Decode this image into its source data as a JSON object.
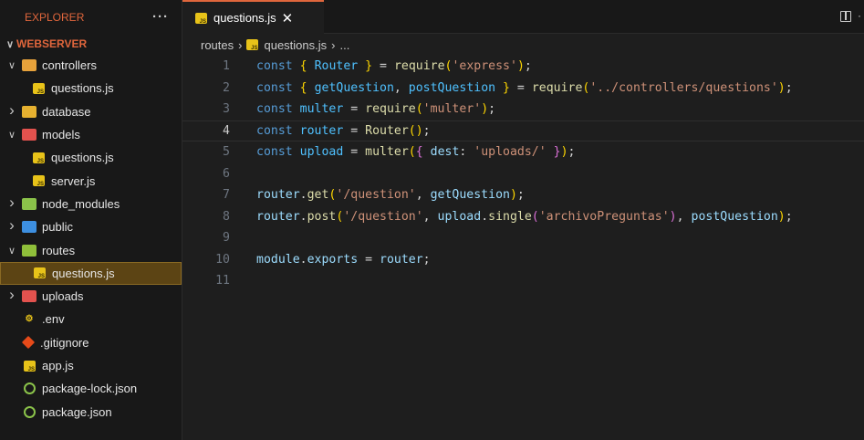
{
  "explorer": {
    "title": "EXPLORER",
    "more": "···",
    "root": "WEBSERVER",
    "items": [
      {
        "label": "controllers",
        "type": "folder",
        "state": "open",
        "color": "orange",
        "depth": 0
      },
      {
        "label": "questions.js",
        "type": "js",
        "depth": 1
      },
      {
        "label": "database",
        "type": "folder",
        "state": "closed",
        "color": "yellow",
        "depth": 0
      },
      {
        "label": "models",
        "type": "folder",
        "state": "open",
        "color": "red",
        "depth": 0
      },
      {
        "label": "questions.js",
        "type": "js",
        "depth": 1
      },
      {
        "label": "server.js",
        "type": "js",
        "depth": 1
      },
      {
        "label": "node_modules",
        "type": "folder",
        "state": "closed",
        "color": "node",
        "depth": 0
      },
      {
        "label": "public",
        "type": "folder",
        "state": "closed",
        "color": "blue",
        "depth": 0
      },
      {
        "label": "routes",
        "type": "folder",
        "state": "open",
        "color": "green",
        "depth": 0
      },
      {
        "label": "questions.js",
        "type": "js",
        "depth": 1,
        "selected": true
      },
      {
        "label": "uploads",
        "type": "folder",
        "state": "closed",
        "color": "red",
        "depth": 0
      },
      {
        "label": ".env",
        "type": "env",
        "depth": 0
      },
      {
        "label": ".gitignore",
        "type": "git",
        "depth": 0
      },
      {
        "label": "app.js",
        "type": "js",
        "depth": 0
      },
      {
        "label": "package-lock.json",
        "type": "npm",
        "depth": 0
      },
      {
        "label": "package.json",
        "type": "npm",
        "depth": 0
      }
    ]
  },
  "tab": {
    "label": "questions.js",
    "close": "✕"
  },
  "breadcrumb": {
    "folder": "routes",
    "file": "questions.js",
    "more": "..."
  },
  "editor": {
    "current_line": 4,
    "lines": [
      {
        "n": "1"
      },
      {
        "n": "2"
      },
      {
        "n": "3"
      },
      {
        "n": "4"
      },
      {
        "n": "5"
      },
      {
        "n": "6"
      },
      {
        "n": "7"
      },
      {
        "n": "8"
      },
      {
        "n": "9"
      },
      {
        "n": "10"
      },
      {
        "n": "11"
      }
    ],
    "code": {
      "l1_kw": "const",
      "l1_router": "Router",
      "l1_require": "require",
      "l1_str": "'express'",
      "l2_kw": "const",
      "l2_get": "getQuestion",
      "l2_post": "postQuestion",
      "l2_require": "require",
      "l2_str": "'../controllers/questions'",
      "l3_kw": "const",
      "l3_var": "multer",
      "l3_require": "require",
      "l3_str": "'multer'",
      "l4_kw": "const",
      "l4_var": "router",
      "l4_fn": "Router",
      "l5_kw": "const",
      "l5_var": "upload",
      "l5_fn": "multer",
      "l5_prop": "dest",
      "l5_str": "'uploads/'",
      "l7_obj": "router",
      "l7_fn": "get",
      "l7_str": "'/question'",
      "l7_arg": "getQuestion",
      "l8_obj": "router",
      "l8_fn": "post",
      "l8_str": "'/question'",
      "l8_obj2": "upload",
      "l8_fn2": "single",
      "l8_str2": "'archivoPreguntas'",
      "l8_arg": "postQuestion",
      "l10_obj": "module",
      "l10_prop": "exports",
      "l10_val": "router"
    }
  }
}
